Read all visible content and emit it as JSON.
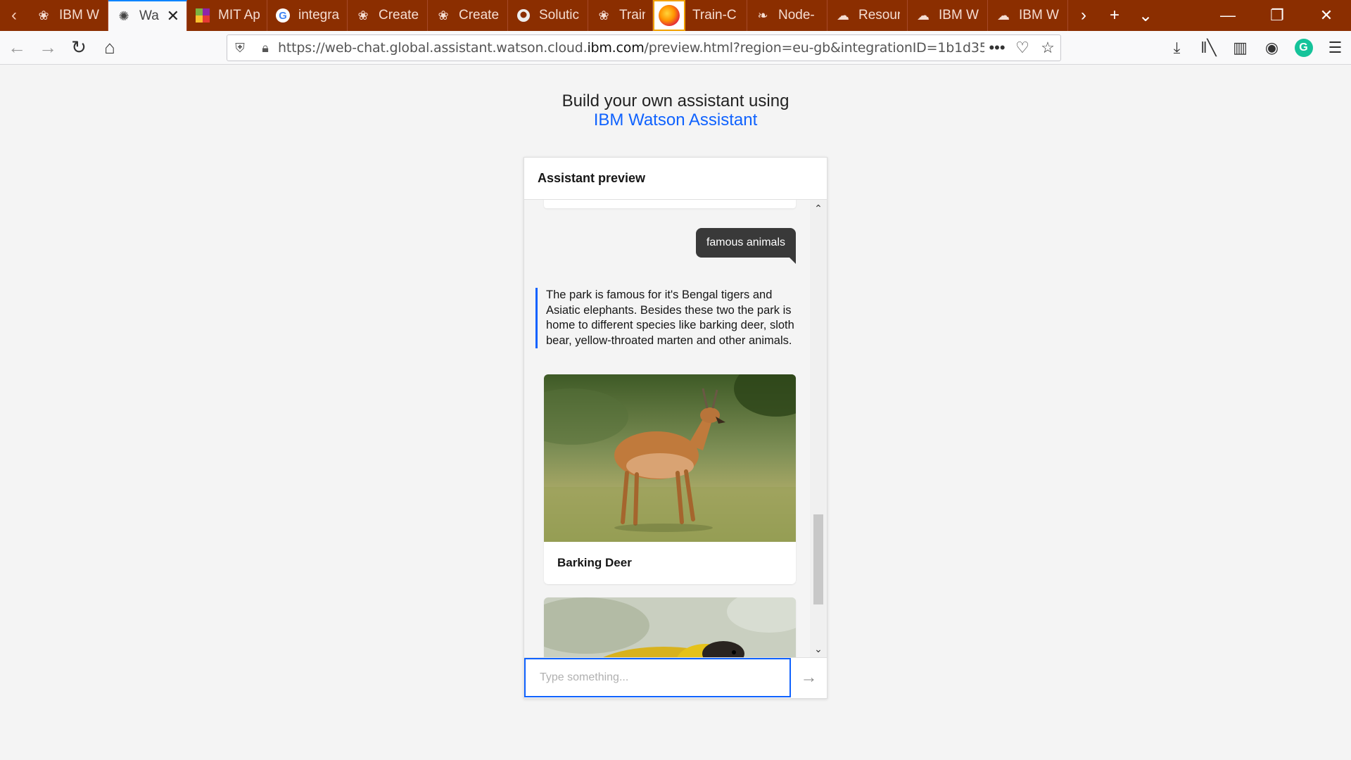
{
  "browser": {
    "tabs": [
      {
        "label": "IBM W",
        "icon": "bee-icon",
        "active": false
      },
      {
        "label": "Wa",
        "icon": "watson-icon",
        "active": true
      },
      {
        "label": "MIT Ap",
        "icon": "mit-icon",
        "active": false
      },
      {
        "label": "integra",
        "icon": "google-icon",
        "active": false
      },
      {
        "label": "Create",
        "icon": "bee-icon",
        "active": false
      },
      {
        "label": "Create",
        "icon": "bee-icon",
        "active": false
      },
      {
        "label": "Solutic",
        "icon": "github-icon",
        "active": false
      },
      {
        "label": "Train a",
        "icon": "bee-icon",
        "active": false
      },
      {
        "label": "Train-C",
        "icon": "firefox-icon",
        "active": false
      },
      {
        "label": "Node-",
        "icon": "nodered-icon",
        "active": false
      },
      {
        "label": "Resour",
        "icon": "cloud-icon",
        "active": false
      },
      {
        "label": "IBM W",
        "icon": "cloud-icon",
        "active": false
      },
      {
        "label": "IBM W",
        "icon": "cloud-icon",
        "active": false
      }
    ],
    "url_prefix": "https://web-chat.global.assistant.watson.cloud.",
    "url_domain": "ibm.com",
    "url_suffix": "/preview.html?region=eu-gb&integrationID=1b1d35",
    "more_glyph": "•••"
  },
  "page": {
    "heading_line1": "Build your own assistant using",
    "heading_link": "IBM Watson Assistant"
  },
  "widget": {
    "title": "Assistant preview",
    "user_message": "famous animals",
    "bot_message": "The park is famous for it's Bengal tigers and Asiatic elephants. Besides these two the park is home to different species like barking deer, sloth bear, yellow-throated marten and other animals.",
    "cards": [
      {
        "caption": "Barking Deer"
      },
      {
        "caption": ""
      }
    ],
    "input_placeholder": "Type something..."
  },
  "colors": {
    "tabstrip": "#8b2e00",
    "accent": "#0f62fe",
    "user_bubble": "#393939"
  }
}
